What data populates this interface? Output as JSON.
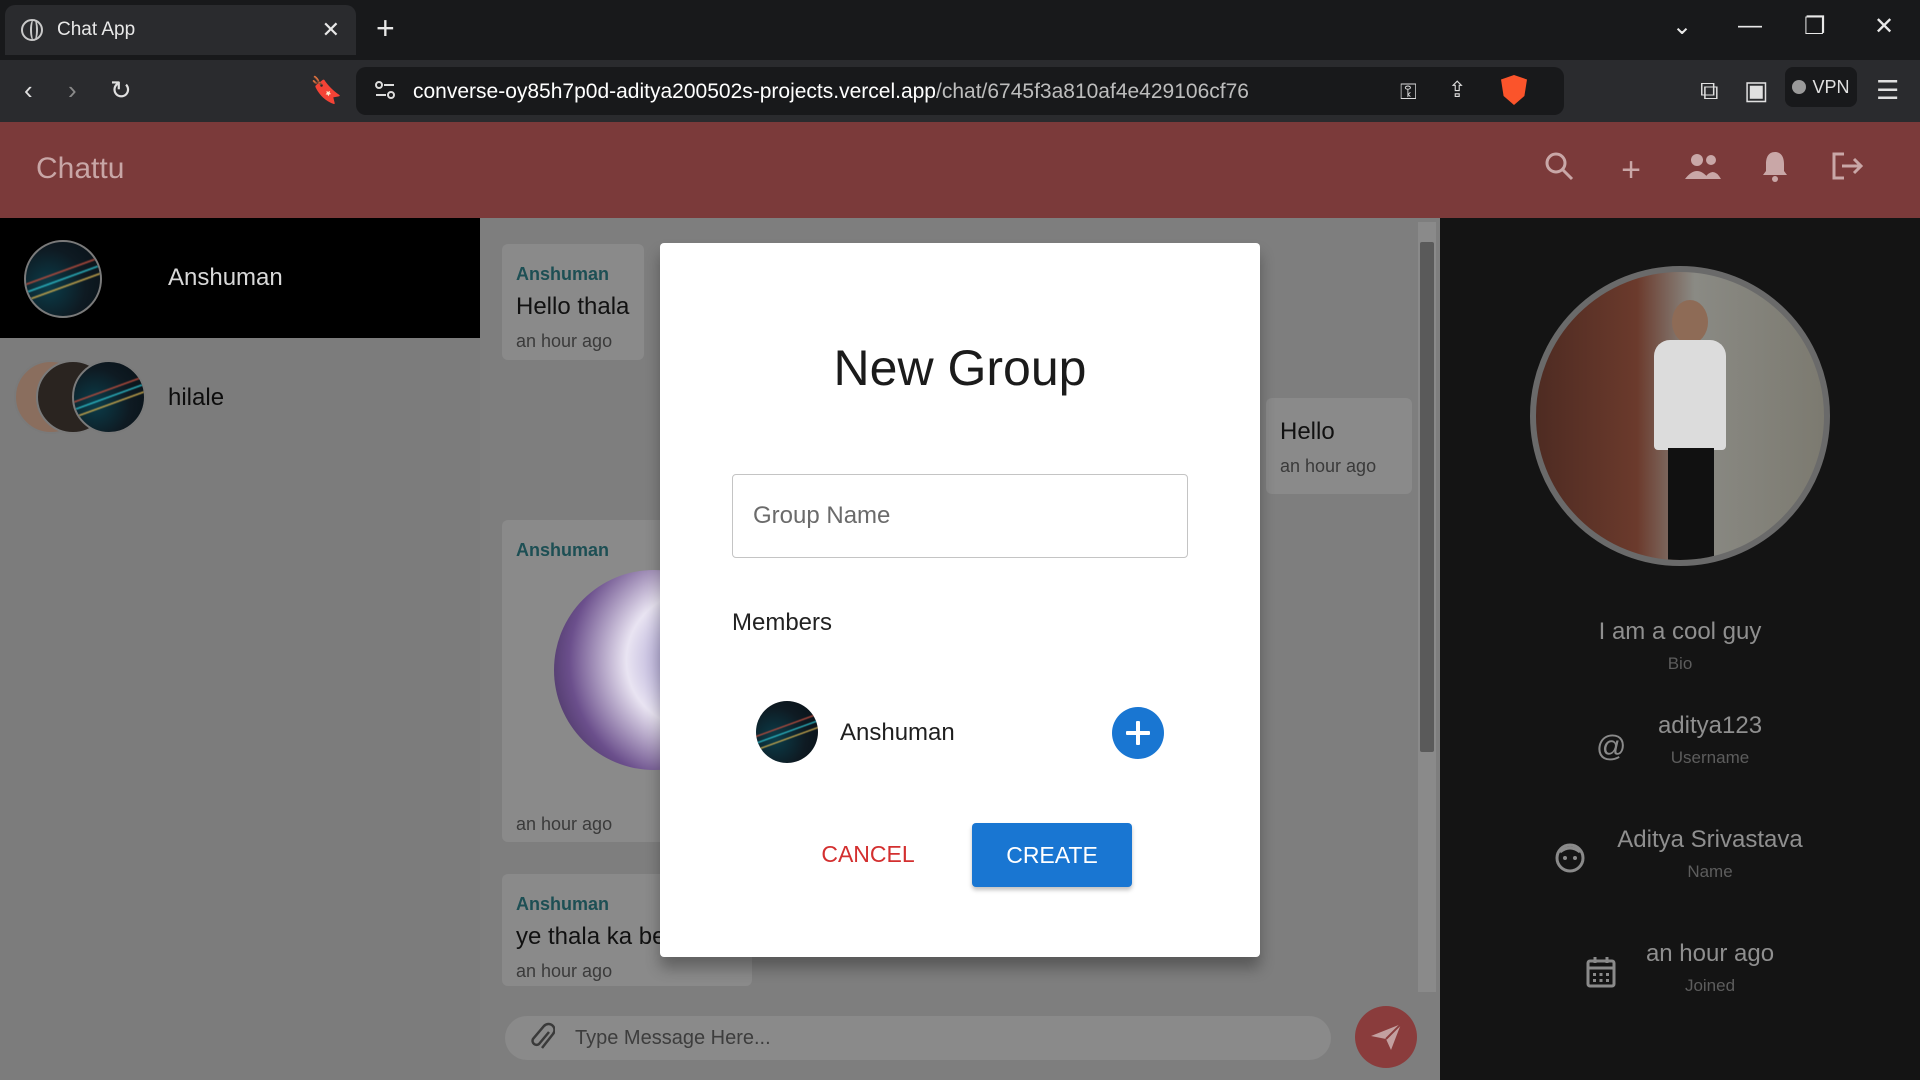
{
  "browser": {
    "tab_title": "Chat App",
    "url_host": "converse-oy85h7p0d-aditya200502s-projects.vercel.app",
    "url_path": "/chat/6745f3a810af4e429106cf76",
    "vpn_label": "VPN"
  },
  "app": {
    "brand": "Chattu",
    "header_icons": [
      "search-icon",
      "add-icon",
      "group-icon",
      "notifications-icon",
      "logout-icon"
    ]
  },
  "chats": [
    {
      "name": "Anshuman",
      "active": true
    },
    {
      "name": "hilale",
      "active": false
    }
  ],
  "messages": [
    {
      "sender": "Anshuman",
      "text": "Hello thala",
      "time": "an hour ago"
    },
    {
      "sender": "",
      "text": "Hello",
      "time": "an hour ago"
    },
    {
      "sender": "Anshuman",
      "text": "",
      "time": "an hour ago"
    },
    {
      "sender": "Anshuman",
      "text": "ye thala ka be",
      "time": "an hour ago"
    }
  ],
  "composer": {
    "placeholder": "Type Message Here..."
  },
  "profile": {
    "bio": "I am a cool guy",
    "bio_label": "Bio",
    "username": "aditya123",
    "username_label": "Username",
    "name": "Aditya Srivastava",
    "name_label": "Name",
    "joined": "an hour ago",
    "joined_label": "Joined"
  },
  "modal": {
    "title": "New Group",
    "group_name_placeholder": "Group Name",
    "members_label": "Members",
    "members": [
      {
        "name": "Anshuman"
      }
    ],
    "cancel_label": "CANCEL",
    "create_label": "CREATE"
  },
  "colors": {
    "header": "#7b3a3a",
    "primary": "#1976d2",
    "cancel": "#d32f2f"
  }
}
